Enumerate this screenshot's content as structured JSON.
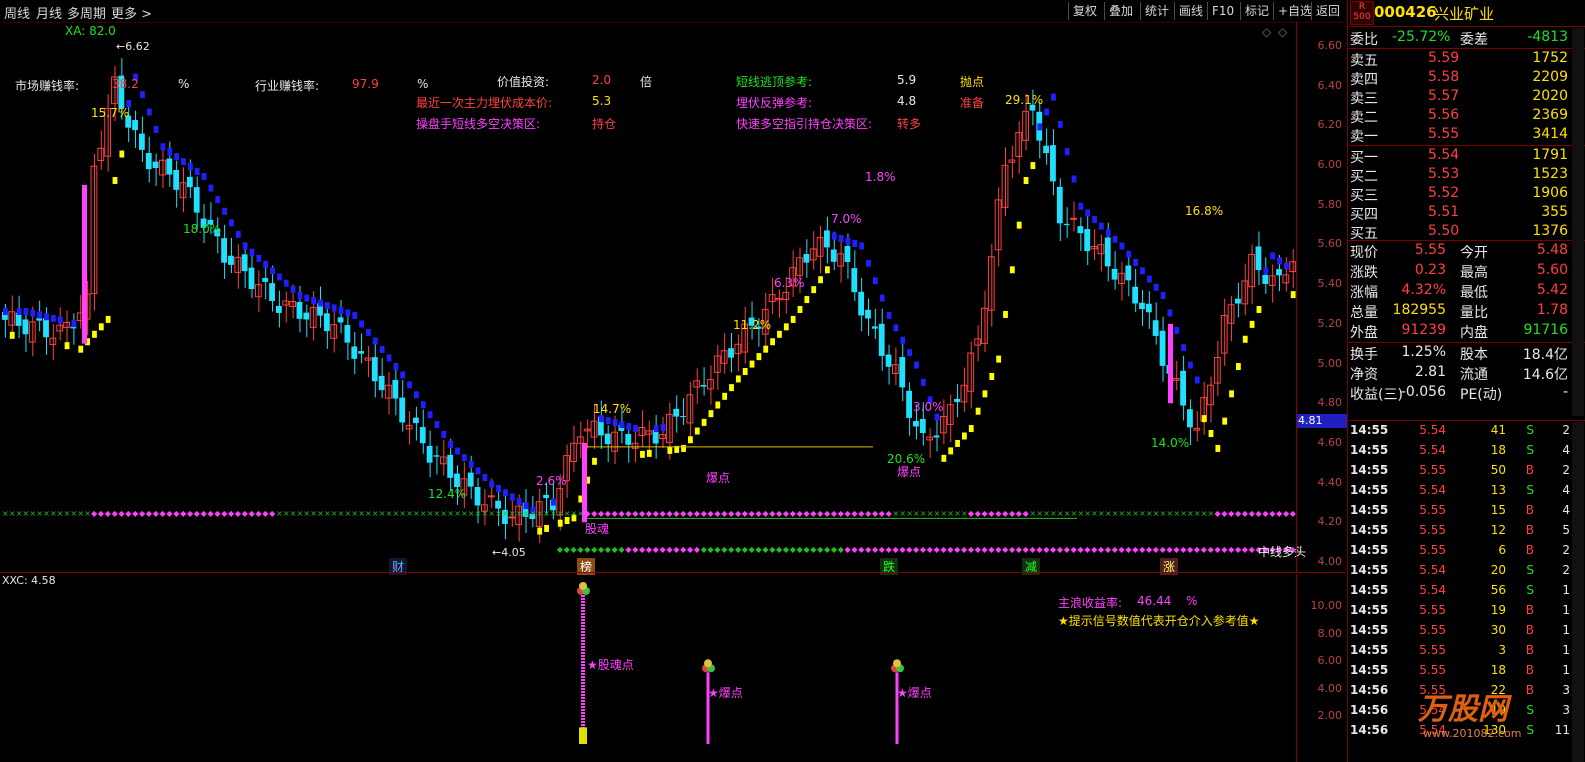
{
  "menu": {
    "items": [
      "周线",
      "月线",
      "多周期",
      "更多 >"
    ],
    "tools": [
      "复权",
      "叠加",
      "统计",
      "画线",
      "F10",
      "标记",
      "+自选",
      "返回"
    ]
  },
  "main": {
    "indicator_label": "XA: 82.0",
    "high_marker": "6.62",
    "low_marker": "4.05",
    "current_price_tag": "4.81",
    "right_label": "中线多头",
    "info": {
      "market_rate_label": "市场赚钱率:",
      "market_rate_value": "38.2",
      "pct1": "%",
      "industry_rate_label": "行业赚钱率:",
      "industry_rate_value": "97.9",
      "pct2": "%",
      "value_invest_label": "价值投资:",
      "value_invest_value": "2.0",
      "times": "倍",
      "cost_label": "最近一次主力埋伏成本价:",
      "cost_value": "5.3",
      "decision_label": "操盘手短线多空决策区:",
      "decision_value": "持仓",
      "escape_label": "短线逃顶参考:",
      "escape_value": "5.9",
      "escape_tag": "抛点",
      "rebound_label": "埋伏反弹参考:",
      "rebound_value": "4.8",
      "rebound_tag": "准备",
      "fast_label": "快速多空指引持仓决策区:",
      "fast_value": "转多"
    },
    "annotations": [
      "15.7%",
      "18.0%",
      "12.4%",
      "2.6%",
      "14.7%",
      "11.2%",
      "6.3%",
      "7.0%",
      "1.8%",
      "3.0%",
      "20.6%",
      "29.1%",
      "16.8%",
      "14.0%"
    ],
    "signal_labels": [
      "股魂",
      "爆点",
      "爆点"
    ],
    "bottom_tags": [
      "财",
      "榜",
      "跌",
      "减",
      "涨"
    ],
    "y_axis": [
      "6.60",
      "6.40",
      "6.20",
      "6.00",
      "5.80",
      "5.60",
      "5.40",
      "5.20",
      "5.00",
      "4.80",
      "4.60",
      "4.40",
      "4.20",
      "4.00"
    ]
  },
  "sub": {
    "indicator_label": "XXC: 4.58",
    "yield_label": "主浪收益率:",
    "yield_value": "46.44",
    "yield_pct": "%",
    "hint": "★提示信号数值代表开仓介入参考值★",
    "signals": [
      "★股魂点",
      "★爆点",
      "★爆点"
    ],
    "y_axis": [
      "10.00",
      "8.00",
      "6.00",
      "4.00",
      "2.00"
    ]
  },
  "quote": {
    "code": "000426",
    "name": "兴业矿业",
    "badge_top": "R",
    "badge_bottom": "500",
    "weibi_label": "委比",
    "weibi_value": "-25.72%",
    "weicha_label": "委差",
    "weicha_value": "-4813",
    "asks": [
      {
        "label": "卖五",
        "price": "5.59",
        "vol": "1752"
      },
      {
        "label": "卖四",
        "price": "5.58",
        "vol": "2209"
      },
      {
        "label": "卖三",
        "price": "5.57",
        "vol": "2020"
      },
      {
        "label": "卖二",
        "price": "5.56",
        "vol": "2369"
      },
      {
        "label": "卖一",
        "price": "5.55",
        "vol": "3414"
      }
    ],
    "bids": [
      {
        "label": "买一",
        "price": "5.54",
        "vol": "1791"
      },
      {
        "label": "买二",
        "price": "5.53",
        "vol": "1523"
      },
      {
        "label": "买三",
        "price": "5.52",
        "vol": "1906"
      },
      {
        "label": "买四",
        "price": "5.51",
        "vol": "355"
      },
      {
        "label": "买五",
        "price": "5.50",
        "vol": "1376"
      }
    ],
    "stats": [
      {
        "l1": "现价",
        "v1": "5.55",
        "l2": "今开",
        "v2": "5.48",
        "c1": "red",
        "c2": "red"
      },
      {
        "l1": "涨跌",
        "v1": "0.23",
        "l2": "最高",
        "v2": "5.60",
        "c1": "red",
        "c2": "red"
      },
      {
        "l1": "涨幅",
        "v1": "4.32%",
        "l2": "最低",
        "v2": "5.42",
        "c1": "red",
        "c2": "red"
      },
      {
        "l1": "总量",
        "v1": "182955",
        "l2": "量比",
        "v2": "1.78",
        "c1": "yellow",
        "c2": "red"
      },
      {
        "l1": "外盘",
        "v1": "91239",
        "l2": "内盘",
        "v2": "91716",
        "c1": "red",
        "c2": "green"
      }
    ],
    "fin": [
      {
        "l1": "换手",
        "v1": "1.25%",
        "l2": "股本",
        "v2": "18.4亿"
      },
      {
        "l1": "净资",
        "v1": "2.81",
        "l2": "流通",
        "v2": "14.6亿"
      },
      {
        "l1": "收益(三)",
        "v1": "-0.056",
        "l2": "PE(动)",
        "v2": "-"
      }
    ],
    "ticks": [
      {
        "t": "14:55",
        "p": "5.54",
        "v": "41",
        "s": "S",
        "n": "2"
      },
      {
        "t": "14:55",
        "p": "5.54",
        "v": "18",
        "s": "S",
        "n": "4"
      },
      {
        "t": "14:55",
        "p": "5.55",
        "v": "50",
        "s": "B",
        "n": "2"
      },
      {
        "t": "14:55",
        "p": "5.54",
        "v": "13",
        "s": "S",
        "n": "4"
      },
      {
        "t": "14:55",
        "p": "5.55",
        "v": "15",
        "s": "B",
        "n": "4"
      },
      {
        "t": "14:55",
        "p": "5.55",
        "v": "12",
        "s": "B",
        "n": "5"
      },
      {
        "t": "14:55",
        "p": "5.55",
        "v": "6",
        "s": "B",
        "n": "2"
      },
      {
        "t": "14:55",
        "p": "5.54",
        "v": "20",
        "s": "S",
        "n": "2"
      },
      {
        "t": "14:55",
        "p": "5.54",
        "v": "56",
        "s": "S",
        "n": "1"
      },
      {
        "t": "14:55",
        "p": "5.55",
        "v": "19",
        "s": "B",
        "n": "1"
      },
      {
        "t": "14:55",
        "p": "5.55",
        "v": "30",
        "s": "B",
        "n": "1"
      },
      {
        "t": "14:55",
        "p": "5.55",
        "v": "3",
        "s": "B",
        "n": "1"
      },
      {
        "t": "14:55",
        "p": "5.55",
        "v": "18",
        "s": "B",
        "n": "1"
      },
      {
        "t": "14:56",
        "p": "5.55",
        "v": "22",
        "s": "B",
        "n": "3"
      },
      {
        "t": "14:56",
        "p": "5.54",
        "v": "19",
        "s": "S",
        "n": "3"
      },
      {
        "t": "14:56",
        "p": "5.54",
        "v": "130",
        "s": "S",
        "n": "11"
      }
    ],
    "watermark": "万股网",
    "watermark_url": "www.201082.com"
  },
  "colors": {
    "up": "#ff4040",
    "down": "#20e0ff",
    "bull": "#ffff00",
    "bear": "#2020ff"
  }
}
